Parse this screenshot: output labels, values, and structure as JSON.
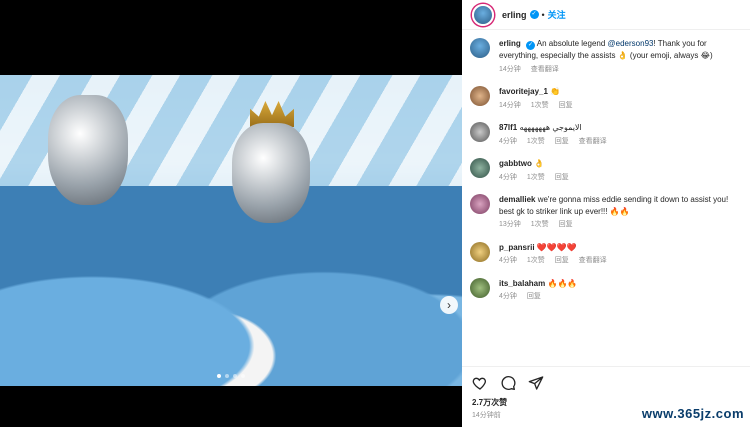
{
  "post": {
    "author": "erling",
    "follow_label": "关注",
    "dot": "•"
  },
  "caption": {
    "user": "erling",
    "text_pre": "An absolute legend ",
    "mention": "@ederson93",
    "text_post": "! Thank you for everything, especially the assists 👌 (your emoji, always 😂)",
    "time": "14分钟",
    "translate": "查看翻译"
  },
  "comments": [
    {
      "user": "favoritejay_1",
      "text": "👏",
      "time": "14分钟",
      "likes": "1次赞",
      "reply": "回复",
      "translate": ""
    },
    {
      "user": "87lf1",
      "text": "الايموجي هههههههه",
      "time": "4分钟",
      "likes": "1次赞",
      "reply": "回复",
      "translate": "查看翻译"
    },
    {
      "user": "gabbtwo",
      "text": "👌",
      "time": "4分钟",
      "likes": "1次赞",
      "reply": "回复",
      "translate": ""
    },
    {
      "user": "demalliek",
      "text": "we're gonna miss eddie sending it down to assist you! best gk to striker link up ever!!! 🔥🔥",
      "time": "13分钟",
      "likes": "1次赞",
      "reply": "回复",
      "translate": ""
    },
    {
      "user": "p_pansrii",
      "text": "❤️❤️❤️❤️",
      "time": "4分钟",
      "likes": "1次赞",
      "reply": "回复",
      "translate": "查看翻译"
    },
    {
      "user": "its_balaham",
      "text": "🔥🔥🔥",
      "time": "4分钟",
      "likes": "",
      "reply": "回复",
      "translate": ""
    }
  ],
  "footer": {
    "likes": "2.7万次赞",
    "time": "14分钟前"
  },
  "watermark": "www.365jz.com",
  "icons": [
    "heart-icon",
    "comment-icon",
    "share-icon"
  ],
  "colors": {
    "link": "#0095f6",
    "mention": "#00376b"
  }
}
